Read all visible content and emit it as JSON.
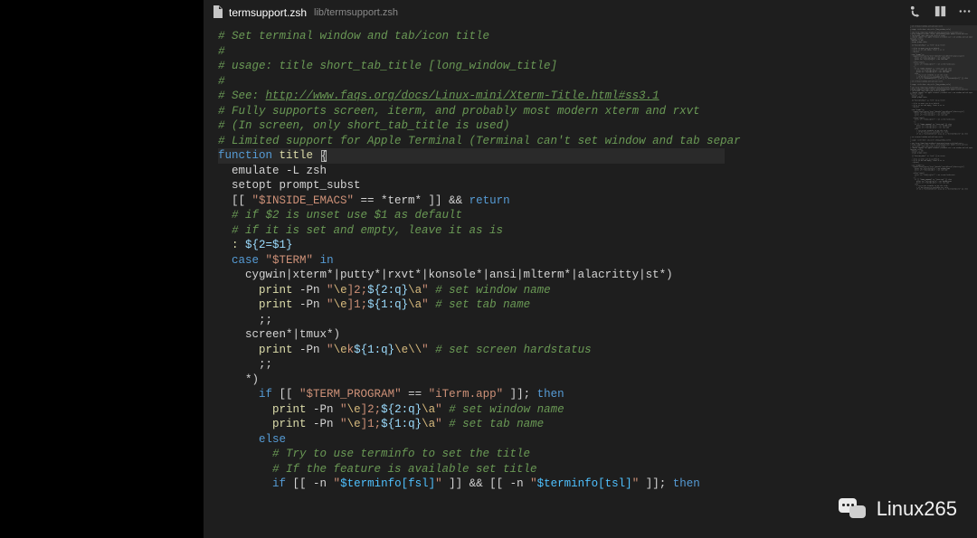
{
  "tab": {
    "filename": "termsupport.zsh",
    "path": "lib/termsupport.zsh"
  },
  "actions": {
    "compare": "compare-changes-icon",
    "split": "split-editor-icon",
    "more": "more-actions-icon"
  },
  "watermark": "Linux265",
  "code": [
    [
      [
        "comment",
        "# Set terminal window and tab/icon title"
      ]
    ],
    [
      [
        "comment",
        "#"
      ]
    ],
    [
      [
        "comment",
        "# usage: title short_tab_title [long_window_title]"
      ]
    ],
    [
      [
        "comment",
        "#"
      ]
    ],
    [
      [
        "comment",
        "# See: "
      ],
      [
        "url",
        "http://www.faqs.org/docs/Linux-mini/Xterm-Title.html#ss3.1"
      ]
    ],
    [
      [
        "comment",
        "# Fully supports screen, iterm, and probably most modern xterm and rxvt"
      ]
    ],
    [
      [
        "comment",
        "# (In screen, only short_tab_title is used)"
      ]
    ],
    [
      [
        "comment",
        "# Limited support for Apple Terminal (Terminal can't set window and tab separ"
      ]
    ],
    [
      [
        "keyword",
        "function"
      ],
      [
        "default",
        " "
      ],
      [
        "func",
        "title"
      ],
      [
        "default",
        " "
      ],
      [
        "cursor",
        ""
      ]
    ],
    [
      [
        "default",
        "  emulate -L zsh"
      ]
    ],
    [
      [
        "default",
        "  setopt prompt_subst"
      ]
    ],
    [
      [
        "default",
        ""
      ]
    ],
    [
      [
        "default",
        "  [[ "
      ],
      [
        "string",
        "\"$INSIDE_EMACS\""
      ],
      [
        "default",
        " == *term* ]] && "
      ],
      [
        "keyword",
        "return"
      ]
    ],
    [
      [
        "default",
        ""
      ]
    ],
    [
      [
        "comment",
        "  # if $2 is unset use $1 as default"
      ]
    ],
    [
      [
        "comment",
        "  # if it is set and empty, leave it as is"
      ]
    ],
    [
      [
        "default",
        "  "
      ],
      [
        "func",
        ":"
      ],
      [
        "default",
        " "
      ],
      [
        "var",
        "${2=$1}"
      ]
    ],
    [
      [
        "default",
        ""
      ]
    ],
    [
      [
        "keyword",
        "  case"
      ],
      [
        "default",
        " "
      ],
      [
        "string",
        "\"$TERM\""
      ],
      [
        "default",
        " "
      ],
      [
        "keyword",
        "in"
      ]
    ],
    [
      [
        "default",
        "    cygwin|xterm*|putty*|rxvt*|konsole*|ansi|mlterm*|alacritty|st*)"
      ]
    ],
    [
      [
        "default",
        "      "
      ],
      [
        "func",
        "print"
      ],
      [
        "default",
        " -Pn "
      ],
      [
        "string",
        "\""
      ],
      [
        "escape",
        "\\e"
      ],
      [
        "string",
        "]2;"
      ],
      [
        "var",
        "${2:q}"
      ],
      [
        "escape",
        "\\a"
      ],
      [
        "string",
        "\""
      ],
      [
        "default",
        " "
      ],
      [
        "comment",
        "# set window name"
      ]
    ],
    [
      [
        "default",
        "      "
      ],
      [
        "func",
        "print"
      ],
      [
        "default",
        " -Pn "
      ],
      [
        "string",
        "\""
      ],
      [
        "escape",
        "\\e"
      ],
      [
        "string",
        "]1;"
      ],
      [
        "var",
        "${1:q}"
      ],
      [
        "escape",
        "\\a"
      ],
      [
        "string",
        "\""
      ],
      [
        "default",
        " "
      ],
      [
        "comment",
        "# set tab name"
      ]
    ],
    [
      [
        "default",
        "      ;;"
      ]
    ],
    [
      [
        "default",
        "    screen*|tmux*)"
      ]
    ],
    [
      [
        "default",
        "      "
      ],
      [
        "func",
        "print"
      ],
      [
        "default",
        " -Pn "
      ],
      [
        "string",
        "\""
      ],
      [
        "escape",
        "\\e"
      ],
      [
        "string",
        "k"
      ],
      [
        "var",
        "${1:q}"
      ],
      [
        "escape",
        "\\e\\\\"
      ],
      [
        "string",
        "\""
      ],
      [
        "default",
        " "
      ],
      [
        "comment",
        "# set screen hardstatus"
      ]
    ],
    [
      [
        "default",
        "      ;;"
      ]
    ],
    [
      [
        "default",
        "    *)"
      ]
    ],
    [
      [
        "default",
        "      "
      ],
      [
        "keyword",
        "if"
      ],
      [
        "default",
        " [[ "
      ],
      [
        "string",
        "\"$TERM_PROGRAM\""
      ],
      [
        "default",
        " == "
      ],
      [
        "string",
        "\"iTerm.app\""
      ],
      [
        "default",
        " ]]; "
      ],
      [
        "keyword",
        "then"
      ]
    ],
    [
      [
        "default",
        "        "
      ],
      [
        "func",
        "print"
      ],
      [
        "default",
        " -Pn "
      ],
      [
        "string",
        "\""
      ],
      [
        "escape",
        "\\e"
      ],
      [
        "string",
        "]2;"
      ],
      [
        "var",
        "${2:q}"
      ],
      [
        "escape",
        "\\a"
      ],
      [
        "string",
        "\""
      ],
      [
        "default",
        " "
      ],
      [
        "comment",
        "# set window name"
      ]
    ],
    [
      [
        "default",
        "        "
      ],
      [
        "func",
        "print"
      ],
      [
        "default",
        " -Pn "
      ],
      [
        "string",
        "\""
      ],
      [
        "escape",
        "\\e"
      ],
      [
        "string",
        "]1;"
      ],
      [
        "var",
        "${1:q}"
      ],
      [
        "escape",
        "\\a"
      ],
      [
        "string",
        "\""
      ],
      [
        "default",
        " "
      ],
      [
        "comment",
        "# set tab name"
      ]
    ],
    [
      [
        "default",
        "      "
      ],
      [
        "keyword",
        "else"
      ]
    ],
    [
      [
        "comment",
        "        # Try to use terminfo to set the title"
      ]
    ],
    [
      [
        "comment",
        "        # If the feature is available set title"
      ]
    ],
    [
      [
        "default",
        "        "
      ],
      [
        "keyword",
        "if"
      ],
      [
        "default",
        " [[ -n "
      ],
      [
        "string",
        "\""
      ],
      [
        "const",
        "$terminfo[fsl]"
      ],
      [
        "string",
        "\""
      ],
      [
        "default",
        " ]] && [[ -n "
      ],
      [
        "string",
        "\""
      ],
      [
        "const",
        "$terminfo[tsl]"
      ],
      [
        "string",
        "\""
      ],
      [
        "default",
        " ]]; "
      ],
      [
        "keyword",
        "then"
      ]
    ]
  ]
}
